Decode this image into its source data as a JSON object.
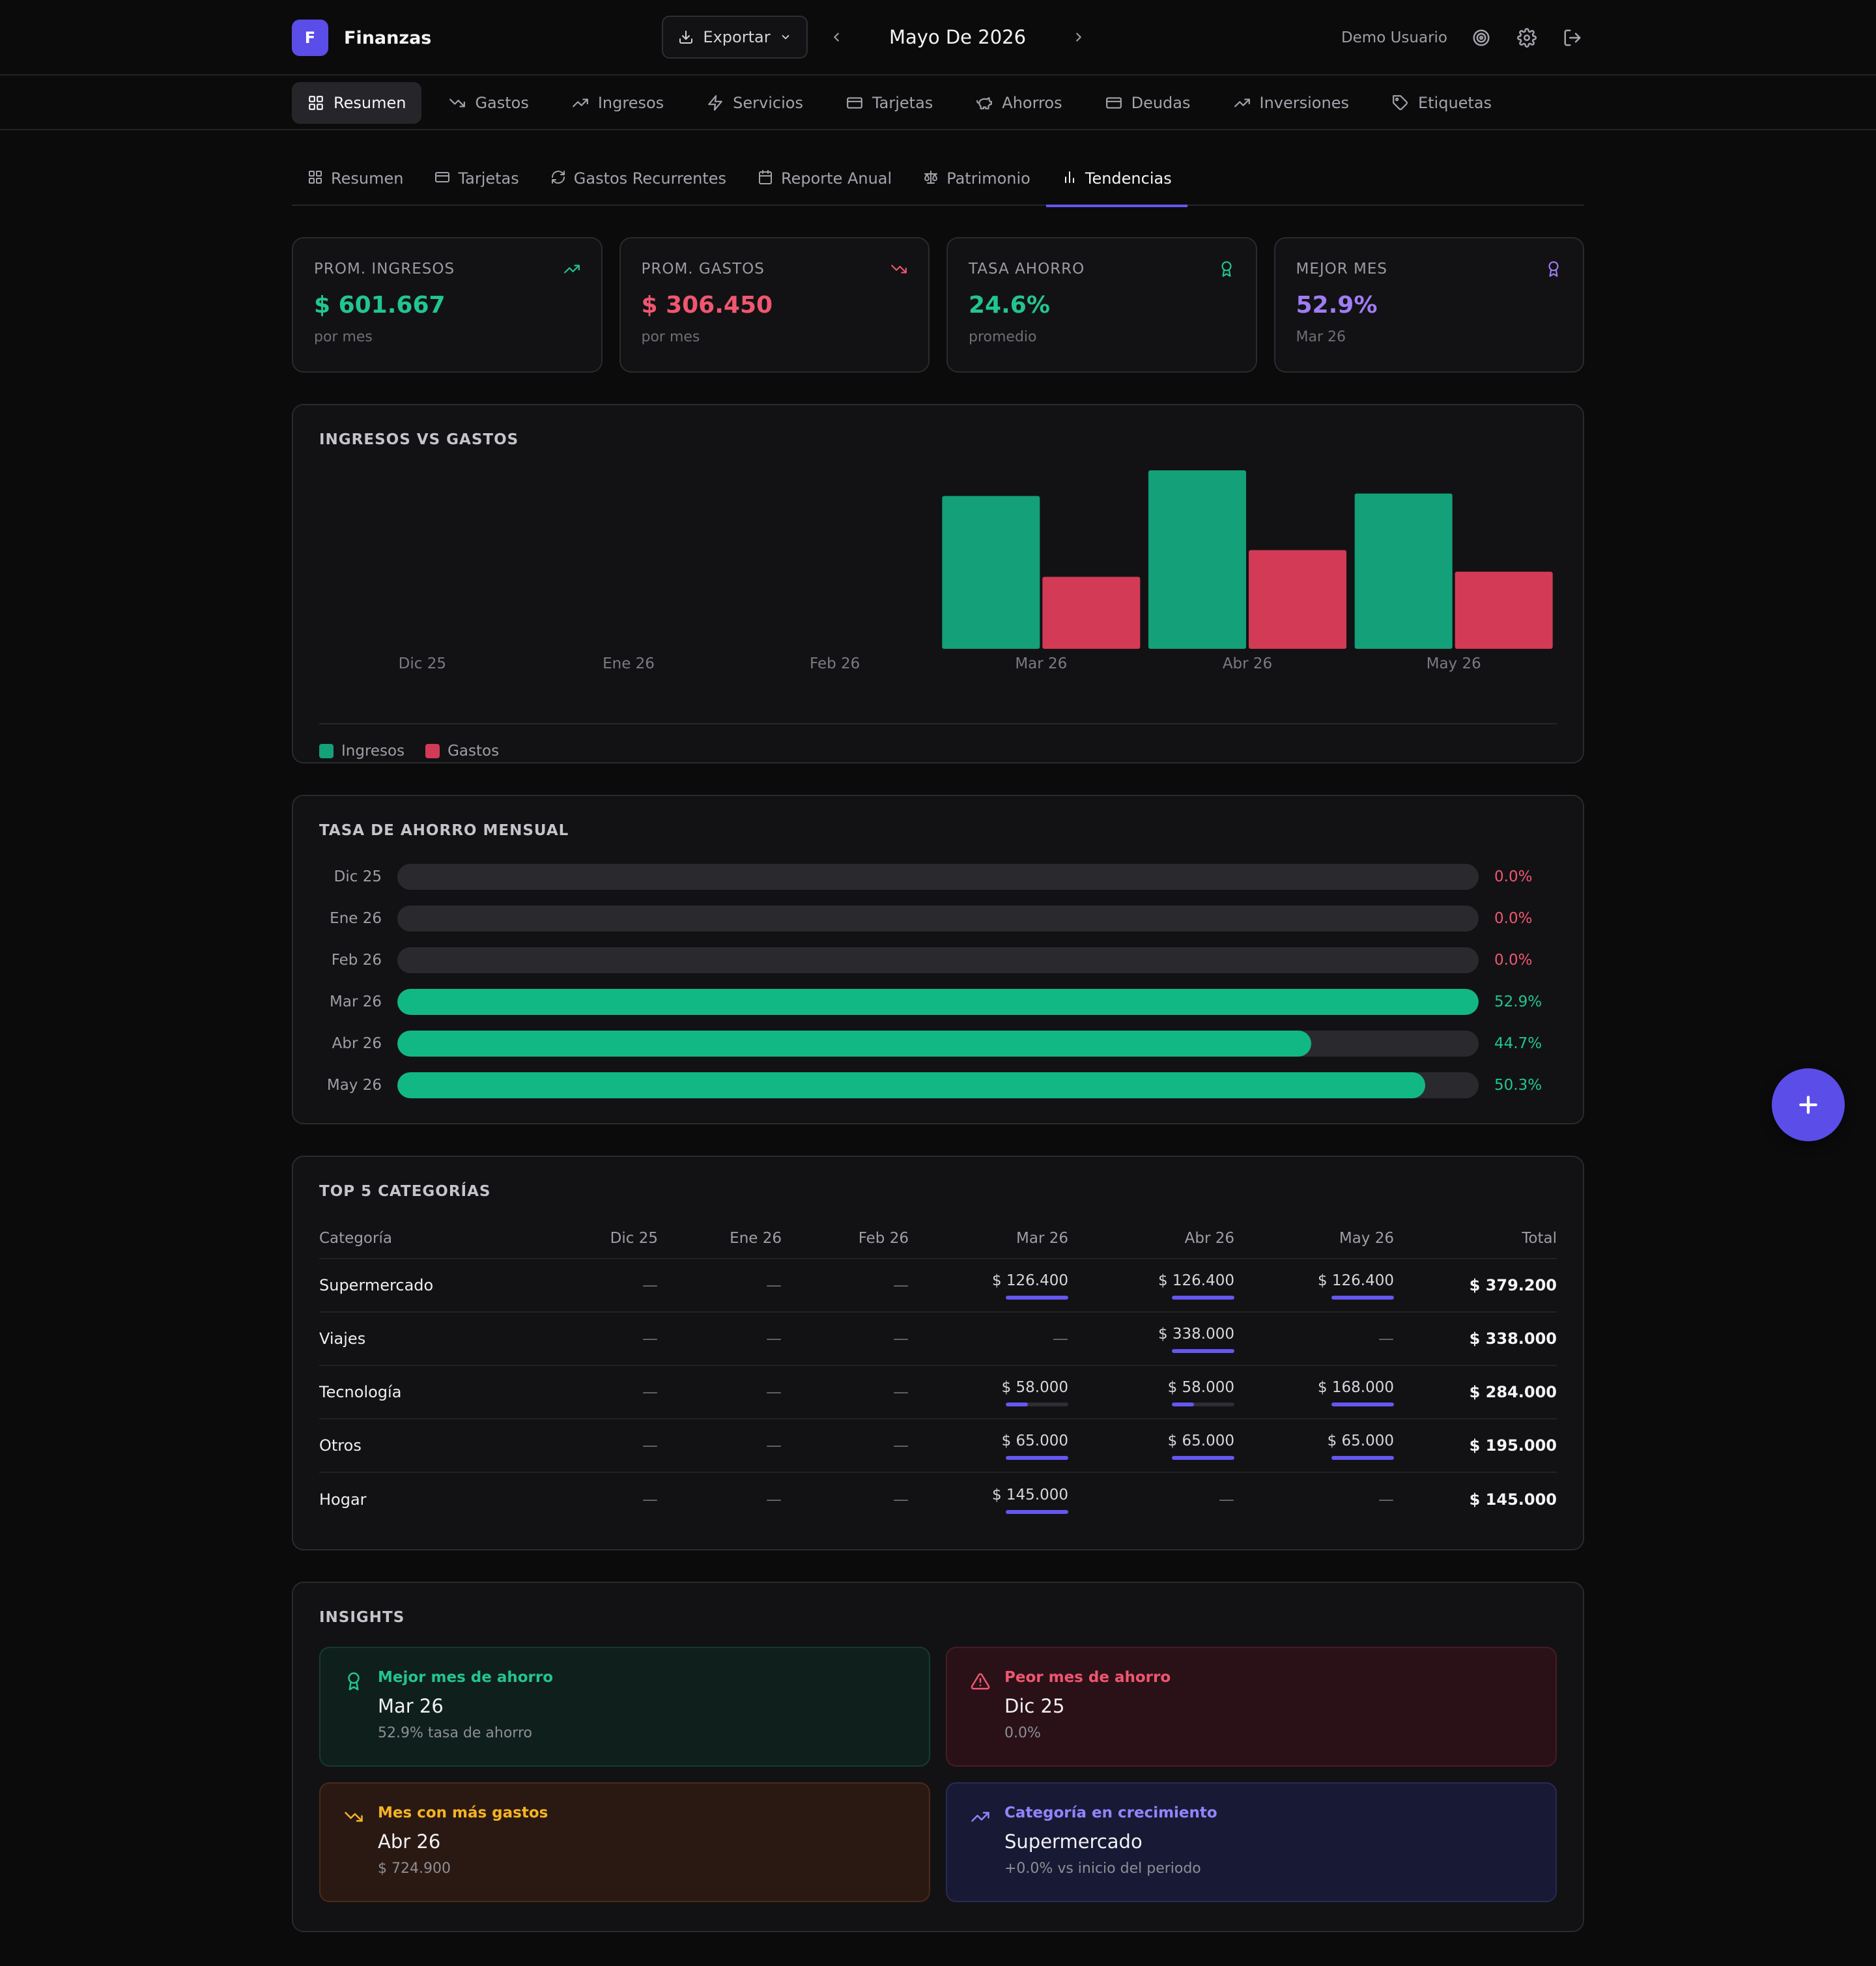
{
  "app": {
    "logo_letter": "F",
    "name": "Finanzas"
  },
  "header": {
    "export_label": "Exportar",
    "month_label": "Mayo De 2026",
    "user_name": "Demo Usuario"
  },
  "main_nav": [
    {
      "label": "Resumen",
      "icon": "grid-icon",
      "active": true
    },
    {
      "label": "Gastos",
      "icon": "trending-down-icon",
      "active": false
    },
    {
      "label": "Ingresos",
      "icon": "trending-up-icon",
      "active": false
    },
    {
      "label": "Servicios",
      "icon": "bolt-icon",
      "active": false
    },
    {
      "label": "Tarjetas",
      "icon": "card-icon",
      "active": false
    },
    {
      "label": "Ahorros",
      "icon": "piggy-bank-icon",
      "active": false
    },
    {
      "label": "Deudas",
      "icon": "card-icon",
      "active": false
    },
    {
      "label": "Inversiones",
      "icon": "trending-up-icon",
      "active": false
    },
    {
      "label": "Etiquetas",
      "icon": "tag-icon",
      "active": false
    }
  ],
  "sub_tabs": [
    {
      "label": "Resumen",
      "icon": "grid-icon",
      "active": false
    },
    {
      "label": "Tarjetas",
      "icon": "card-icon",
      "active": false
    },
    {
      "label": "Gastos Recurrentes",
      "icon": "refresh-icon",
      "active": false
    },
    {
      "label": "Reporte Anual",
      "icon": "calendar-icon",
      "active": false
    },
    {
      "label": "Patrimonio",
      "icon": "scale-icon",
      "active": false
    },
    {
      "label": "Tendencias",
      "icon": "bar-chart-icon",
      "active": true
    }
  ],
  "stats": [
    {
      "label": "PROM. INGRESOS",
      "value": "$ 601.667",
      "sub": "por mes",
      "color": "#22c592",
      "icon": "trending-up-icon"
    },
    {
      "label": "PROM. GASTOS",
      "value": "$ 306.450",
      "sub": "por mes",
      "color": "#f0566f",
      "icon": "trending-down-icon"
    },
    {
      "label": "TASA AHORRO",
      "value": "24.6%",
      "sub": "promedio",
      "color": "#22c592",
      "icon": "award-icon"
    },
    {
      "label": "MEJOR MES",
      "value": "52.9%",
      "sub": "Mar 26",
      "color": "#a07cf5",
      "icon": "award-icon"
    }
  ],
  "income_vs_expense": {
    "title": "INGRESOS VS GASTOS",
    "legend": {
      "income": "Ingresos",
      "expense": "Gastos"
    },
    "colors": {
      "income": "#14a079",
      "expense": "#d33a55"
    }
  },
  "chart_data": {
    "type": "bar",
    "categories": [
      "Dic 25",
      "Ene 26",
      "Feb 26",
      "Mar 26",
      "Abr 26",
      "May 26"
    ],
    "series": [
      {
        "name": "Ingresos",
        "values": [
          0,
          0,
          0,
          567000,
          662000,
          576000
        ]
      },
      {
        "name": "Gastos",
        "values": [
          0,
          0,
          0,
          267000,
          366000,
          286000
        ]
      }
    ],
    "ylim": [
      0,
      662000
    ],
    "legend": "bottom-left",
    "grid": false
  },
  "savings_rate": {
    "title": "TASA DE AHORRO MENSUAL",
    "rows": [
      {
        "label": "Dic 25",
        "value": 0.0,
        "text": "0.0%",
        "color": "#f0566f"
      },
      {
        "label": "Ene 26",
        "value": 0.0,
        "text": "0.0%",
        "color": "#f0566f"
      },
      {
        "label": "Feb 26",
        "value": 0.0,
        "text": "0.0%",
        "color": "#f0566f"
      },
      {
        "label": "Mar 26",
        "value": 52.9,
        "text": "52.9%",
        "color": "#22c592"
      },
      {
        "label": "Abr 26",
        "value": 44.7,
        "text": "44.7%",
        "color": "#22c592"
      },
      {
        "label": "May 26",
        "value": 50.3,
        "text": "50.3%",
        "color": "#22c592"
      }
    ],
    "max": 52.9
  },
  "top_categories": {
    "title": "TOP 5 CATEGORÍAS",
    "headers": [
      "Categoría",
      "Dic 25",
      "Ene 26",
      "Feb 26",
      "Mar 26",
      "Abr 26",
      "May 26",
      "Total"
    ],
    "rows": [
      {
        "name": "Supermercado",
        "cells": [
          "—",
          "—",
          "—",
          "$ 126.400",
          "$ 126.400",
          "$ 126.400"
        ],
        "fills": [
          0,
          0,
          0,
          1,
          1,
          1
        ],
        "total": "$ 379.200"
      },
      {
        "name": "Viajes",
        "cells": [
          "—",
          "—",
          "—",
          "—",
          "$ 338.000",
          "—"
        ],
        "fills": [
          0,
          0,
          0,
          0,
          1,
          0
        ],
        "total": "$ 338.000"
      },
      {
        "name": "Tecnología",
        "cells": [
          "—",
          "—",
          "—",
          "$ 58.000",
          "$ 58.000",
          "$ 168.000"
        ],
        "fills": [
          0,
          0,
          0,
          0.35,
          0.35,
          1
        ],
        "total": "$ 284.000"
      },
      {
        "name": "Otros",
        "cells": [
          "—",
          "—",
          "—",
          "$ 65.000",
          "$ 65.000",
          "$ 65.000"
        ],
        "fills": [
          0,
          0,
          0,
          1,
          1,
          1
        ],
        "total": "$ 195.000"
      },
      {
        "name": "Hogar",
        "cells": [
          "—",
          "—",
          "—",
          "$ 145.000",
          "—",
          "—"
        ],
        "fills": [
          0,
          0,
          0,
          1,
          0,
          0
        ],
        "total": "$ 145.000"
      }
    ]
  },
  "insights": {
    "title": "INSIGHTS",
    "items": [
      {
        "title": "Mejor mes de ahorro",
        "main": "Mar 26",
        "sub": "52.9% tasa de ahorro",
        "color": "#22c592",
        "icon": "award-icon",
        "tone": "ins-green"
      },
      {
        "title": "Peor mes de ahorro",
        "main": "Dic 25",
        "sub": "0.0%",
        "color": "#f0566f",
        "icon": "alert-triangle-icon",
        "tone": "ins-red"
      },
      {
        "title": "Mes con más gastos",
        "main": "Abr 26",
        "sub": "$ 724.900",
        "color": "#f5b324",
        "icon": "trending-down-icon",
        "tone": "ins-orange"
      },
      {
        "title": "Categoría en crecimiento",
        "main": "Supermercado",
        "sub": "+0.0% vs inicio del periodo",
        "color": "#8f86ff",
        "icon": "trending-up-icon",
        "tone": "ins-blue"
      }
    ]
  }
}
